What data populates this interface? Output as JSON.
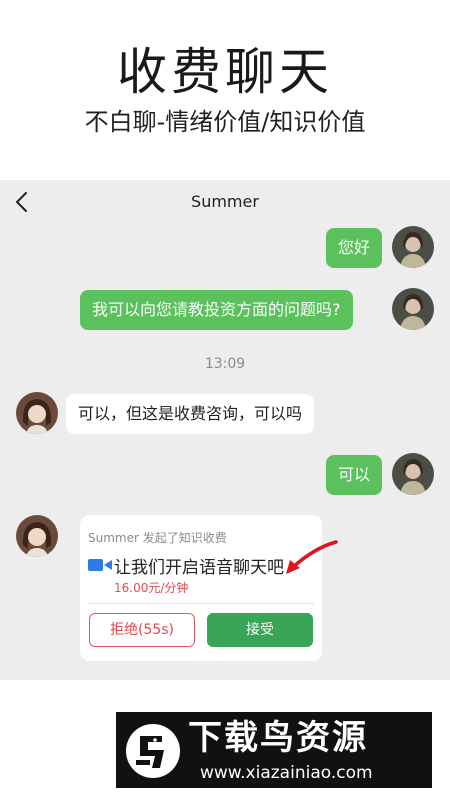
{
  "hero": {
    "title": "收费聊天",
    "subtitle": "不白聊-情绪价值/知识价值"
  },
  "chat": {
    "header": {
      "back_icon": "chevron-left-icon",
      "contact_name": "Summer"
    },
    "messages": [
      {
        "from": "me",
        "text": "您好"
      },
      {
        "from": "me",
        "text": "我可以向您请教投资方面的问题吗?"
      },
      {
        "from": "other",
        "text": "可以，但这是收费咨询，可以吗"
      },
      {
        "from": "me",
        "text": "可以"
      }
    ],
    "timestamp": "13:09",
    "request_card": {
      "header": "Summer 发起了知识收费",
      "icon": "video-camera-icon",
      "message": "让我们开启语音聊天吧",
      "price": "16.00元/分钟",
      "reject_label": "拒绝(55s)",
      "accept_label": "接受"
    }
  },
  "watermark": {
    "name": "下载鸟资源",
    "url": "www.xiazainiao.com"
  },
  "colors": {
    "bubble_green": "#5ac15d",
    "accept_green": "#3aa457",
    "reject_red": "#e24b4b",
    "chat_bg": "#ededed"
  }
}
